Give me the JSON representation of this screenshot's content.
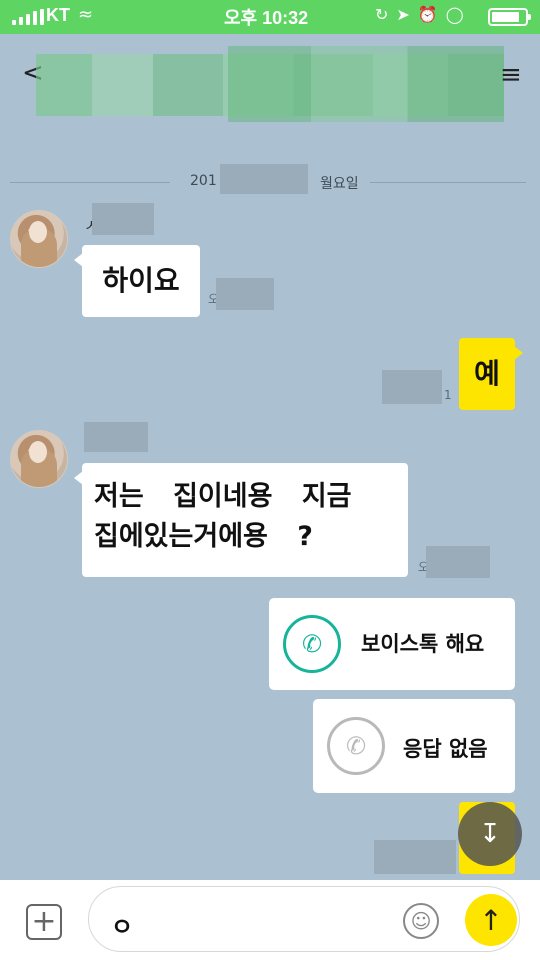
{
  "status_bar": {
    "carrier": "KT",
    "time": "오후 10:32",
    "battery_level": 0.85
  },
  "header": {
    "back_icon": "<",
    "menu_icon": "≡"
  },
  "date_divider": {
    "prefix": "201",
    "suffix": "월요일"
  },
  "messages": [
    {
      "sender": "ㅅ",
      "text": "하이요",
      "side": "left",
      "time_fragment": "오"
    },
    {
      "text": "예",
      "side": "right",
      "time_fragment": "1"
    },
    {
      "sender": "ㅅ",
      "text": "저는 집이네용 지금 집에있는거에용 ?",
      "side": "left",
      "time_fragment": "오"
    }
  ],
  "calls": [
    {
      "label": "보이스톡 해요",
      "icon": "phone-icon",
      "color": "#17b39b"
    },
    {
      "label": "응답 없음",
      "icon": "phone-icon",
      "color": "#b9b9b9"
    }
  ],
  "input": {
    "value": "ㅇ",
    "plus_icon": "+",
    "emoji_icon": "smile-icon",
    "send_icon": "arrow-up-icon"
  },
  "colors": {
    "chat_background": "#abc1d1",
    "status_bar": "#5ed563",
    "my_bubble": "#fee500",
    "voice_call_accent": "#17b39b"
  }
}
